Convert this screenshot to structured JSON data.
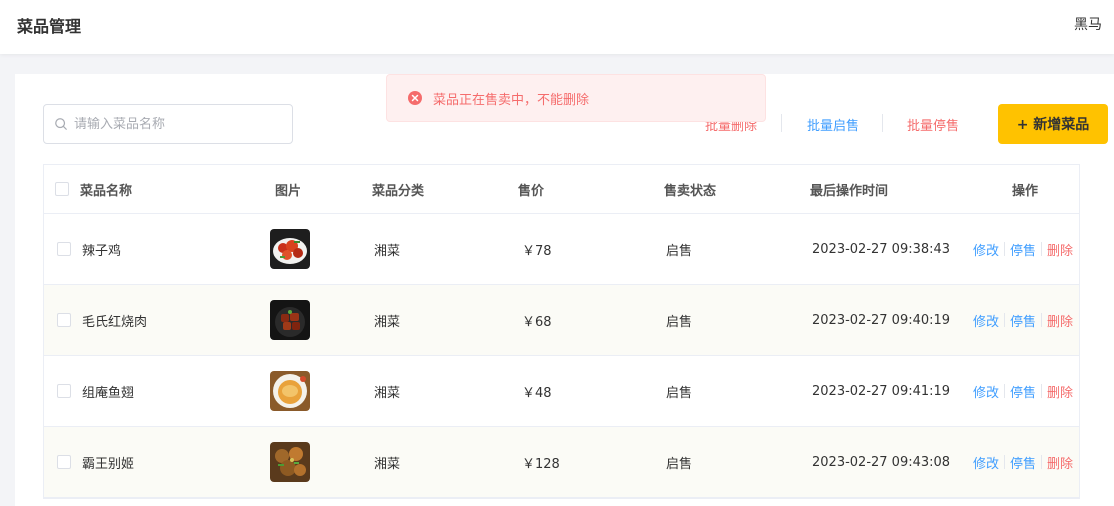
{
  "header": {
    "title": "菜品管理",
    "user": "黑马"
  },
  "search": {
    "placeholder": "请输入菜品名称"
  },
  "toolbar": {
    "batch_delete": "批量删除",
    "batch_on": "批量启售",
    "batch_off": "批量停售",
    "add": "+ 新增菜品"
  },
  "toast": {
    "message": "菜品正在售卖中，不能删除",
    "type": "error"
  },
  "table": {
    "columns": [
      "菜品名称",
      "图片",
      "菜品分类",
      "售价",
      "售卖状态",
      "最后操作时间",
      "操作"
    ],
    "rows": [
      {
        "name": "辣子鸡",
        "category": "湘菜",
        "price": "￥78",
        "status": "启售",
        "time": "2023-02-27 09:38:43"
      },
      {
        "name": "毛氏红烧肉",
        "category": "湘菜",
        "price": "￥68",
        "status": "启售",
        "time": "2023-02-27 09:40:19"
      },
      {
        "name": "组庵鱼翅",
        "category": "湘菜",
        "price": "￥48",
        "status": "启售",
        "time": "2023-02-27 09:41:19"
      },
      {
        "name": "霸王别姬",
        "category": "湘菜",
        "price": "￥128",
        "status": "启售",
        "time": "2023-02-27 09:43:08"
      }
    ],
    "ops": {
      "edit": "修改",
      "stop": "停售",
      "delete": "删除"
    }
  },
  "colors": {
    "accent": "#ffc200",
    "link": "#409eff",
    "danger": "#f56c6c"
  }
}
